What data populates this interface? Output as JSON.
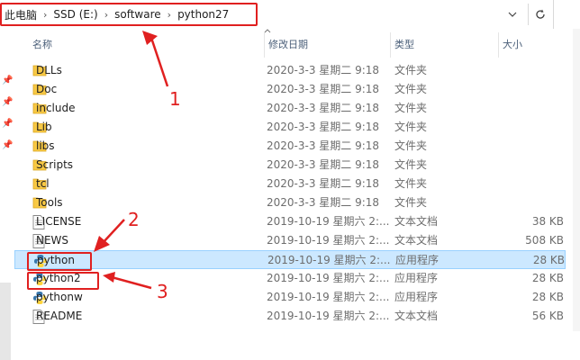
{
  "address": {
    "crumbs": [
      "此电脑",
      "SSD (E:)",
      "software",
      "python27"
    ],
    "separator": "›",
    "dropdown_icon": "chevron-down-icon",
    "refresh_icon": "refresh-icon"
  },
  "columns": {
    "name": "名称",
    "date": "修改日期",
    "type": "类型",
    "size": "大小"
  },
  "files": [
    {
      "name": "DLLs",
      "date": "2020-3-3 星期二 9:18",
      "type": "文件夹",
      "size": "",
      "icon": "folder"
    },
    {
      "name": "Doc",
      "date": "2020-3-3 星期二 9:18",
      "type": "文件夹",
      "size": "",
      "icon": "folder"
    },
    {
      "name": "include",
      "date": "2020-3-3 星期二 9:18",
      "type": "文件夹",
      "size": "",
      "icon": "folder"
    },
    {
      "name": "Lib",
      "date": "2020-3-3 星期二 9:18",
      "type": "文件夹",
      "size": "",
      "icon": "folder"
    },
    {
      "name": "libs",
      "date": "2020-3-3 星期二 9:18",
      "type": "文件夹",
      "size": "",
      "icon": "folder"
    },
    {
      "name": "Scripts",
      "date": "2020-3-3 星期二 9:18",
      "type": "文件夹",
      "size": "",
      "icon": "folder"
    },
    {
      "name": "tcl",
      "date": "2020-3-3 星期二 9:18",
      "type": "文件夹",
      "size": "",
      "icon": "folder"
    },
    {
      "name": "Tools",
      "date": "2020-3-3 星期二 9:18",
      "type": "文件夹",
      "size": "",
      "icon": "folder"
    },
    {
      "name": "LICENSE",
      "date": "2019-10-19 星期六 2:...",
      "type": "文本文档",
      "size": "38 KB",
      "icon": "text"
    },
    {
      "name": "NEWS",
      "date": "2019-10-19 星期六 2:...",
      "type": "文本文档",
      "size": "508 KB",
      "icon": "text"
    },
    {
      "name": "python",
      "date": "2019-10-19 星期六 2:...",
      "type": "应用程序",
      "size": "28 KB",
      "icon": "python",
      "selected": true
    },
    {
      "name": "python2",
      "date": "2019-10-19 星期六 2:...",
      "type": "应用程序",
      "size": "28 KB",
      "icon": "python"
    },
    {
      "name": "pythonw",
      "date": "2019-10-19 星期六 2:...",
      "type": "应用程序",
      "size": "28 KB",
      "icon": "python"
    },
    {
      "name": "README",
      "date": "2019-10-19 星期六 2:...",
      "type": "文本文档",
      "size": "56 KB",
      "icon": "text"
    }
  ],
  "annotations": [
    "1",
    "2",
    "3"
  ],
  "colors": {
    "annotation": "#e02020",
    "selection": "#cce8ff",
    "folder": "#f8c945"
  }
}
